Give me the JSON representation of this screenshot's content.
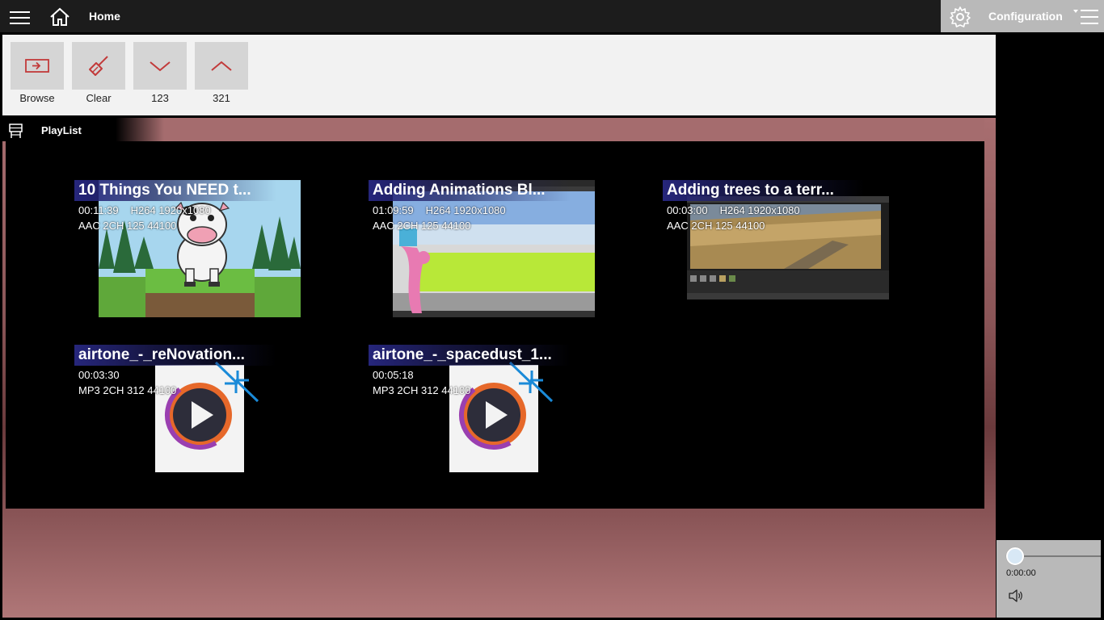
{
  "header": {
    "title": "Home",
    "config_label": "Configuration"
  },
  "toolbar": {
    "browse_label": "Browse",
    "clear_label": "Clear",
    "sort_asc_label": "123",
    "sort_desc_label": "321"
  },
  "playlist": {
    "title": "PlayList",
    "items": [
      {
        "title": "10 Things You NEED t...",
        "duration": "00:11:39",
        "video": "H264 1920x1080",
        "audio": "AAC 2CH 125 44100",
        "thumbnail": "cartoon-cow"
      },
      {
        "title": "Adding Animations Bl...",
        "duration": "01:09:59",
        "video": "H264 1920x1080",
        "audio": "AAC 2CH 125 44100",
        "thumbnail": "animation-editor"
      },
      {
        "title": "Adding trees to a terr...",
        "duration": "00:03:00",
        "video": "H264 1920x1080",
        "audio": "AAC 2CH 125 44100",
        "thumbnail": "terrain-editor"
      },
      {
        "title": "airtone_-_reNovation...",
        "duration": "00:03:30",
        "video": "",
        "audio": "MP3 2CH 312 44100",
        "thumbnail": "audio-file-icon"
      },
      {
        "title": "airtone_-_spacedust_1...",
        "duration": "00:05:18",
        "video": "",
        "audio": "MP3 2CH 312 44100",
        "thumbnail": "audio-file-icon"
      }
    ]
  },
  "player": {
    "time": "0:00:00",
    "position": 0
  },
  "colors": {
    "accent": "#c23a3a",
    "title_bar": "#1c1c1c",
    "config_bg": "#b9b9b9"
  },
  "icons": {
    "menu": "hamburger-icon",
    "home": "home-icon",
    "settings": "gear-icon",
    "browse": "folder-open-icon",
    "clear": "broom-icon",
    "sort_asc": "chevron-down-icon",
    "sort_desc": "chevron-up-icon",
    "playlist": "playlist-icon",
    "volume": "speaker-icon"
  }
}
